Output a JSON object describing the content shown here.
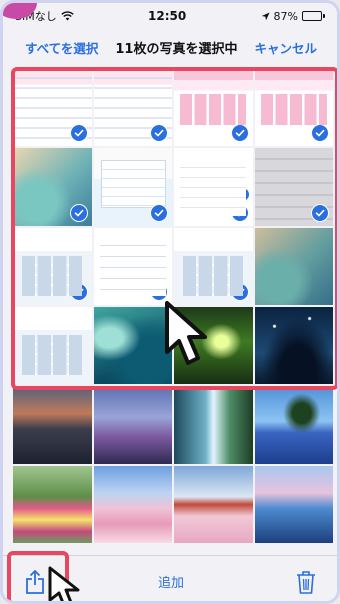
{
  "status_bar": {
    "carrier": "SIMなし",
    "time": "12:50",
    "battery_percent": "87%",
    "battery_level": 0.87
  },
  "nav_bar": {
    "select_all_label": "すべてを選択",
    "title": "11枚の写真を選択中",
    "cancel_label": "キャンセル"
  },
  "toolbar": {
    "share_icon": "share-icon",
    "add_label": "追加",
    "trash_icon": "trash-icon"
  },
  "colors": {
    "accent": "#2a6fe0",
    "highlight": "#e8475f",
    "background": "#f2f2f6"
  },
  "photos": [
    {
      "row": 1,
      "col": 1,
      "kind": "screenshot-document",
      "selected": true
    },
    {
      "row": 1,
      "col": 2,
      "kind": "screenshot-document",
      "selected": true
    },
    {
      "row": 1,
      "col": 3,
      "kind": "screenshot-banner",
      "selected": true
    },
    {
      "row": 1,
      "col": 4,
      "kind": "screenshot-banner",
      "selected": true
    },
    {
      "row": 2,
      "col": 1,
      "kind": "screenshot-wallpaper",
      "selected": true
    },
    {
      "row": 2,
      "col": 2,
      "kind": "screenshot-settings",
      "selected": true
    },
    {
      "row": 2,
      "col": 3,
      "kind": "screenshot-share-sheet",
      "selected": true
    },
    {
      "row": 2,
      "col": 4,
      "kind": "screenshot-gray",
      "selected": true
    },
    {
      "row": 3,
      "col": 1,
      "kind": "screenshot-calculator",
      "selected": true
    },
    {
      "row": 3,
      "col": 2,
      "kind": "screenshot-menu",
      "selected": true
    },
    {
      "row": 3,
      "col": 3,
      "kind": "screenshot-calculator",
      "selected": true
    },
    {
      "row": 3,
      "col": 4,
      "kind": "screenshot-wallpaper",
      "selected": false
    },
    {
      "row": 4,
      "col": 1,
      "kind": "screenshot-calculator",
      "selected": false
    },
    {
      "row": 4,
      "col": 2,
      "kind": "photo-ocean",
      "selected": false
    },
    {
      "row": 4,
      "col": 3,
      "kind": "photo-forest",
      "selected": false
    },
    {
      "row": 4,
      "col": 4,
      "kind": "photo-tree-night",
      "selected": false
    },
    {
      "row": 5,
      "col": 1,
      "kind": "photo-fuji-sunset",
      "selected": false
    },
    {
      "row": 5,
      "col": 2,
      "kind": "photo-windmill",
      "selected": false
    },
    {
      "row": 5,
      "col": 3,
      "kind": "photo-waterfall",
      "selected": false
    },
    {
      "row": 5,
      "col": 4,
      "kind": "photo-blue-field",
      "selected": false
    },
    {
      "row": 6,
      "col": 1,
      "kind": "photo-tulips",
      "selected": false
    },
    {
      "row": 6,
      "col": 2,
      "kind": "photo-fuji-sakura",
      "selected": false
    },
    {
      "row": 6,
      "col": 3,
      "kind": "photo-pagoda",
      "selected": false
    },
    {
      "row": 6,
      "col": 4,
      "kind": "photo-clouds",
      "selected": false
    }
  ]
}
